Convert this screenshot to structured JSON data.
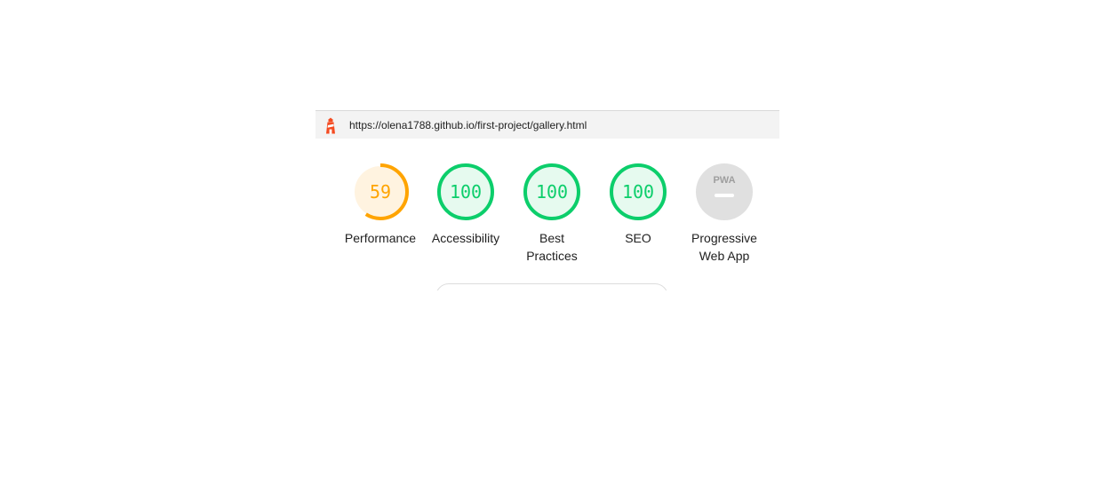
{
  "url": "https://olena1788.github.io/first-project/gallery.html",
  "colors": {
    "fail_or_average": "#ffa400",
    "average_bg": "#fff3e0",
    "pass": "#0cce6b",
    "pass_bg": "#e6faef",
    "pass_text": "#008800",
    "na_bg": "#e0e0e0",
    "na_text": "#9e9e9e",
    "lighthouse_icon": "#f44b21"
  },
  "gauges": [
    {
      "id": "performance",
      "score": "59",
      "fraction": 0.59,
      "status": "average",
      "label_lines": [
        "Performance"
      ]
    },
    {
      "id": "accessibility",
      "score": "100",
      "fraction": 1.0,
      "status": "pass",
      "label_lines": [
        "Accessibility"
      ]
    },
    {
      "id": "best-practices",
      "score": "100",
      "fraction": 1.0,
      "status": "pass",
      "label_lines": [
        "Best",
        "Practices"
      ]
    },
    {
      "id": "seo",
      "score": "100",
      "fraction": 1.0,
      "status": "pass",
      "label_lines": [
        "SEO"
      ]
    },
    {
      "id": "pwa",
      "score": "PWA",
      "fraction": null,
      "status": "na",
      "label_lines": [
        "Progressive",
        "Web App"
      ],
      "icon": "pwa-badge-icon"
    }
  ]
}
